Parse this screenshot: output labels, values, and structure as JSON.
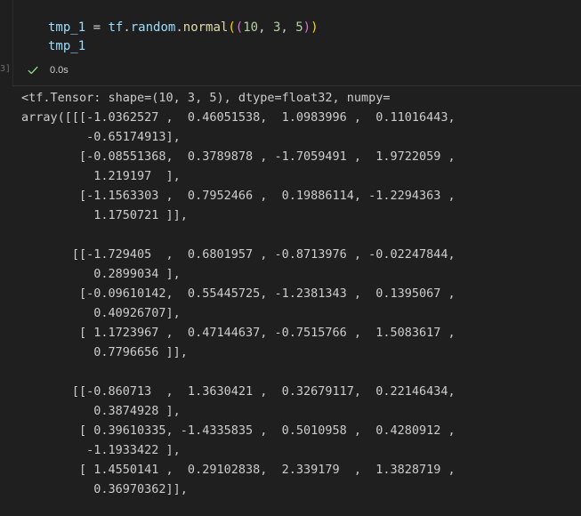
{
  "code_cell": {
    "execution_count": "3]",
    "line1": {
      "var": "tmp_1",
      "eq": " = ",
      "module": "tf",
      "dot1": ".",
      "submodule": "random",
      "dot2": ".",
      "func": "normal",
      "open_outer": "(",
      "open_inner": "(",
      "n1": "10",
      "comma1": ", ",
      "n2": "3",
      "comma2": ", ",
      "n3": "5",
      "close_inner": ")",
      "close_outer": ")"
    },
    "line2": "tmp_1",
    "status_icon": "check-icon",
    "duration": "0.0s"
  },
  "output": {
    "lines": [
      "<tf.Tensor: shape=(10, 3, 5), dtype=float32, numpy=",
      "array([[[-1.0362527 ,  0.46051538,  1.0983996 ,  0.11016443,",
      "         -0.65174913],",
      "        [-0.08551368,  0.3789878 , -1.7059491 ,  1.9722059 ,",
      "          1.219197  ],",
      "        [-1.1563303 ,  0.7952466 ,  0.19886114, -1.2294363 ,",
      "          1.1750721 ]],",
      "",
      "       [[-1.729405  ,  0.6801957 , -0.8713976 , -0.02247844,",
      "          0.2899034 ],",
      "        [-0.09610142,  0.55445725, -1.2381343 ,  0.1395067 ,",
      "          0.40926707],",
      "        [ 1.1723967 ,  0.47144637, -0.7515766 ,  1.5083617 ,",
      "          0.7796656 ]],",
      "",
      "       [[-0.860713  ,  1.3630421 ,  0.32679117,  0.22146434,",
      "          0.3874928 ],",
      "        [ 0.39610335, -1.4335835 ,  0.5010958 ,  0.4280912 ,",
      "         -1.1933422 ],",
      "        [ 1.4550141 ,  0.29102838,  2.339179  ,  1.3828719 ,",
      "          0.36970362]],"
    ]
  },
  "colors": {
    "background": "#1f1f1f",
    "check": "#89d185",
    "identifier": "#9cdcfe",
    "function": "#dcdcaa",
    "number": "#b5cea8",
    "bracket_outer": "#ffd700",
    "bracket_inner": "#da70d6"
  }
}
